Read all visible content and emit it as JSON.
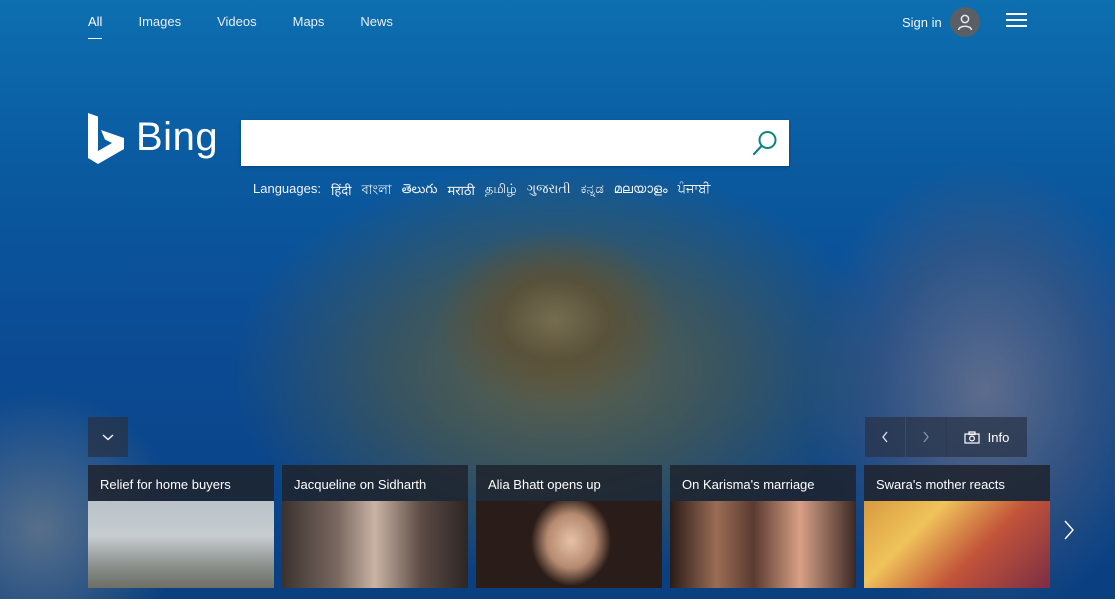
{
  "nav": {
    "tabs": [
      {
        "label": "All"
      },
      {
        "label": "Images"
      },
      {
        "label": "Videos"
      },
      {
        "label": "Maps"
      },
      {
        "label": "News"
      }
    ],
    "signin_label": "Sign in"
  },
  "logo": {
    "text": "Bing"
  },
  "search": {
    "value": "",
    "placeholder": ""
  },
  "languages": {
    "label": "Languages:",
    "items": [
      "हिंदी",
      "বাংলা",
      "తెలుగు",
      "मराठी",
      "தமிழ்",
      "ગુજરાતી",
      "ಕನ್ನಡ",
      "മലയാളം",
      "ਪੰਜਾਬੀ"
    ]
  },
  "info": {
    "label": "Info"
  },
  "cards": [
    {
      "title": "Relief for home buyers"
    },
    {
      "title": "Jacqueline on Sidharth"
    },
    {
      "title": "Alia Bhatt opens up"
    },
    {
      "title": "On Karisma's marriage"
    },
    {
      "title": "Swara's mother reacts"
    }
  ],
  "icons": {
    "search": "search-icon",
    "avatar": "user-icon",
    "menu": "hamburger-icon",
    "collapse": "chevron-down-icon",
    "prev": "chevron-left-icon",
    "next": "chevron-right-icon",
    "camera": "camera-icon"
  },
  "colors": {
    "accent": "#0c8484",
    "card_bg": "#1e232d"
  }
}
